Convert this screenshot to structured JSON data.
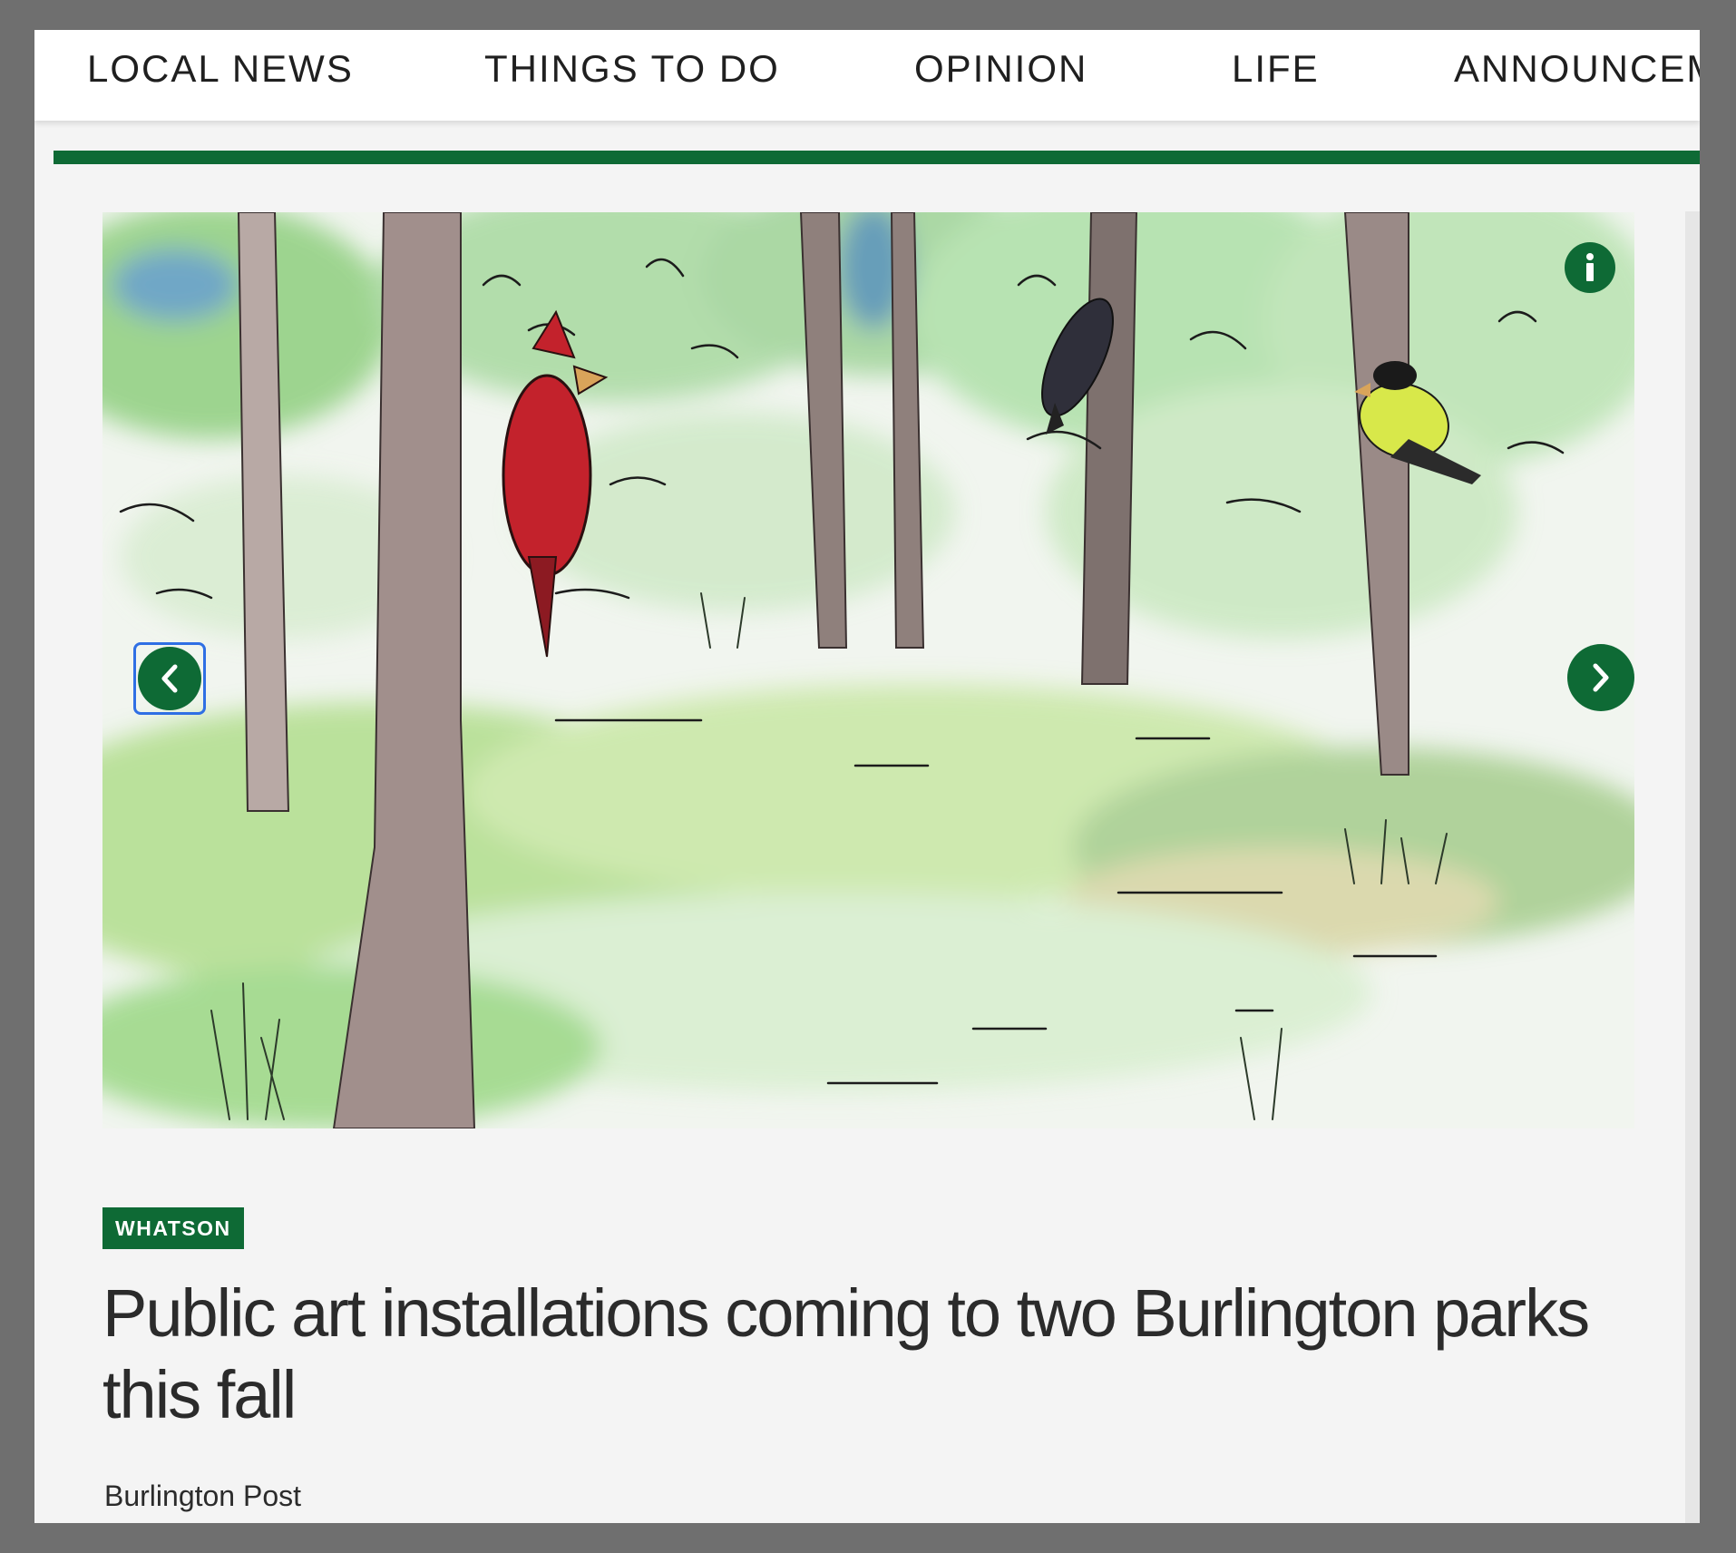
{
  "nav": {
    "items": [
      {
        "label": "LOCAL NEWS"
      },
      {
        "label": "THINGS TO DO"
      },
      {
        "label": "OPINION"
      },
      {
        "label": "LIFE"
      },
      {
        "label": "ANNOUNCEMENTS"
      }
    ],
    "accent_color": "#0e6a35"
  },
  "hero": {
    "controls": {
      "prev_icon": "chevron-left-icon",
      "next_icon": "chevron-right-icon",
      "info_icon": "info-icon"
    }
  },
  "article": {
    "category": "WHATSON",
    "headline": "Public art installations coming to two Burlington parks this fall",
    "byline": "Burlington Post"
  }
}
